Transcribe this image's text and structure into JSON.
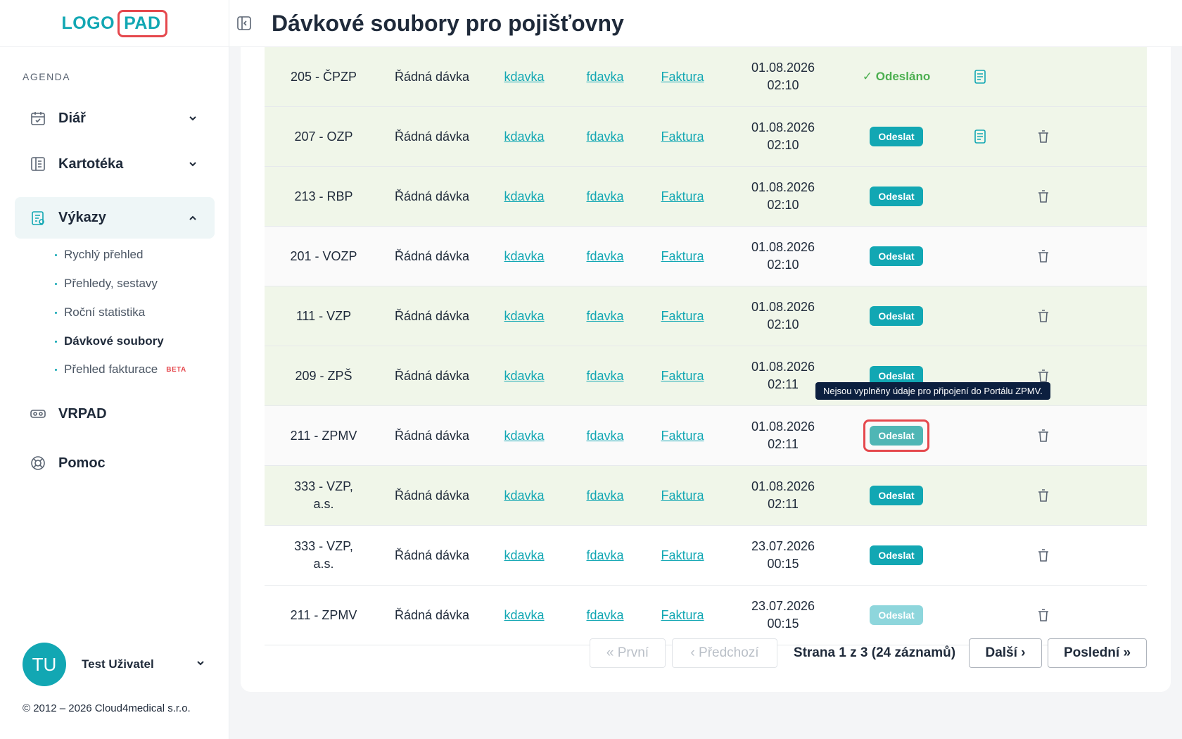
{
  "logo": {
    "left": "LOGO",
    "right": "PAD"
  },
  "sidebar": {
    "section": "AGENDA",
    "items": [
      {
        "label": "Diář"
      },
      {
        "label": "Kartotéka"
      },
      {
        "label": "Výkazy"
      },
      {
        "label": "VRPAD"
      },
      {
        "label": "Pomoc"
      }
    ],
    "sub_items": [
      {
        "label": "Rychlý přehled"
      },
      {
        "label": "Přehledy, sestavy"
      },
      {
        "label": "Roční statistika"
      },
      {
        "label": "Dávkové soubory"
      },
      {
        "label": "Přehled fakturace",
        "badge": "BETA"
      }
    ],
    "user": {
      "initials": "TU",
      "name": "Test Uživatel"
    },
    "copyright": "© 2012 – 2026 Cloud4medical s.r.o."
  },
  "header": {
    "title": "Dávkové soubory pro pojišťovny"
  },
  "table": {
    "link_k": "kdavka",
    "link_f": "fdavka",
    "link_fak": "Faktura",
    "send_label": "Odeslat",
    "rows": [
      {
        "ins": [
          "205 - ČPZP"
        ],
        "type": "Řádná dávka",
        "date": "01.08.2026",
        "time": "02:10",
        "status": "✓ Odesláno"
      },
      {
        "ins": [
          "207 - OZP"
        ],
        "type": "Řádná dávka",
        "date": "01.08.2026",
        "time": "02:10",
        "status": "Odeslat"
      },
      {
        "ins": [
          "213 - RBP"
        ],
        "type": "Řádná dávka",
        "date": "01.08.2026",
        "time": "02:10",
        "status": "Odeslat"
      },
      {
        "ins": [
          "201 - VOZP"
        ],
        "type": "Řádná dávka",
        "date": "01.08.2026",
        "time": "02:10",
        "status": "Odeslat"
      },
      {
        "ins": [
          "111 - VZP"
        ],
        "type": "Řádná dávka",
        "date": "01.08.2026",
        "time": "02:10",
        "status": "Odeslat"
      },
      {
        "ins": [
          "209 - ZPŠ"
        ],
        "type": "Řádná dávka",
        "date": "01.08.2026",
        "time": "02:11",
        "status": "Odeslat"
      },
      {
        "ins": [
          "211 - ZPMV"
        ],
        "type": "Řádná dávka",
        "date": "01.08.2026",
        "time": "02:11",
        "status": "Odeslat"
      },
      {
        "ins": [
          "333 - VZP,",
          "a.s."
        ],
        "type": "Řádná dávka",
        "date": "01.08.2026",
        "time": "02:11",
        "status": "Odeslat"
      },
      {
        "ins": [
          "333 - VZP,",
          "a.s."
        ],
        "type": "Řádná dávka",
        "date": "23.07.2026",
        "time": "00:15",
        "status": "Odeslat"
      },
      {
        "ins": [
          "211 - ZPMV"
        ],
        "type": "Řádná dávka",
        "date": "23.07.2026",
        "time": "00:15",
        "status": "Odeslat"
      }
    ]
  },
  "tooltip": "Nejsou vyplněny údaje pro připojení do Portálu ZPMV.",
  "pagination": {
    "first": "« První",
    "prev": "‹ Předchozí",
    "info": "Strana 1 z 3 (24 záznamů)",
    "next": "Další ›",
    "last": "Poslední »"
  },
  "colors": {
    "accent": "#12a7b3",
    "danger": "#e5484d",
    "row_green": "#f0f6e9",
    "tooltip_bg": "#0c1f3f"
  }
}
